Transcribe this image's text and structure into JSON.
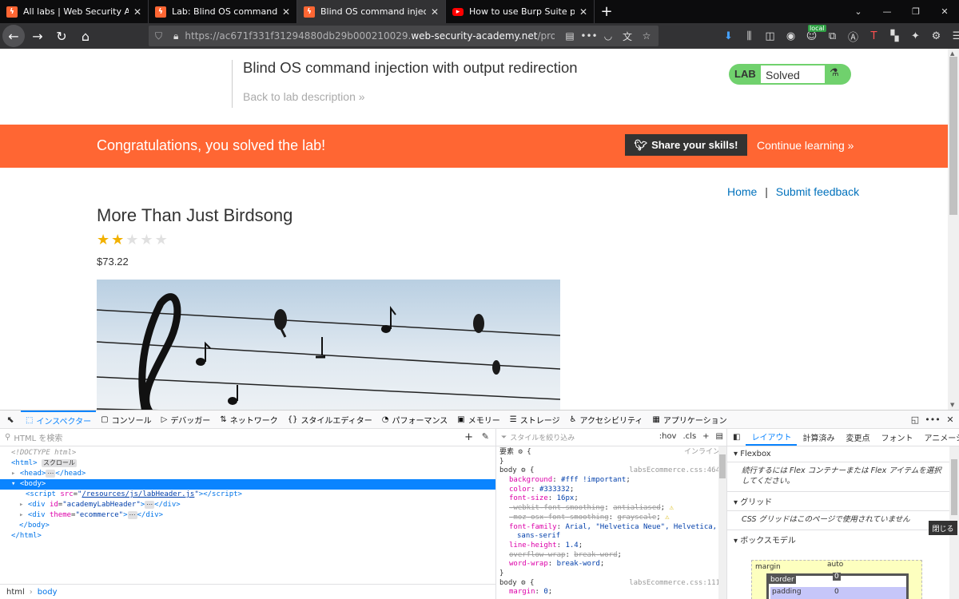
{
  "browser": {
    "tabs": [
      {
        "title": "All labs | Web Security Academy",
        "icon": "portswigger-icon"
      },
      {
        "title": "Lab: Blind OS command injection",
        "icon": "portswigger-icon"
      },
      {
        "title": "Blind OS command injection w",
        "icon": "portswigger-icon"
      },
      {
        "title": "How to use Burp Suite projects",
        "icon": "youtube-icon"
      }
    ],
    "url_prefix": "https://ac671f331f31294880db29b000210029.",
    "url_host": "web-security-academy.net",
    "url_path": "/product?productId",
    "local_badge": "local"
  },
  "page": {
    "lab_title": "Blind OS command injection with output redirection",
    "back_link": "Back to lab description »",
    "lab_label": "LAB",
    "lab_status": "Solved",
    "banner_text": "Congratulations, you solved the lab!",
    "share_button": "Share your skills!",
    "continue_link": "Continue learning »",
    "home_link": "Home",
    "separator": "|",
    "feedback_link": "Submit feedback",
    "product_title": "More Than Just Birdsong",
    "rating": 2,
    "rating_max": 5,
    "price": "$73.22"
  },
  "devtools": {
    "tabs": [
      {
        "label": "インスペクター",
        "icon": "⬚"
      },
      {
        "label": "コンソール",
        "icon": "▢"
      },
      {
        "label": "デバッガー",
        "icon": "▷"
      },
      {
        "label": "ネットワーク",
        "icon": "⇅"
      },
      {
        "label": "スタイルエディター",
        "icon": "{}"
      },
      {
        "label": "パフォーマンス",
        "icon": "◔"
      },
      {
        "label": "メモリー",
        "icon": "▣"
      },
      {
        "label": "ストレージ",
        "icon": "☰"
      },
      {
        "label": "アクセシビリティ",
        "icon": "♿"
      },
      {
        "label": "アプリケーション",
        "icon": "▦"
      }
    ],
    "html_search_placeholder": "HTML を検索",
    "tree": {
      "doctype": "<!DOCTYPE html>",
      "html_open": "<html>",
      "scroll_badge": "スクロール",
      "head": "<head>",
      "head_close": "</head>",
      "body_open": "<body>",
      "script_src": "/resources/js/labHeader.js",
      "div1_id": "academyLabHeader",
      "div2_theme": "ecommerce",
      "body_close": "</body>",
      "html_close": "</html>"
    },
    "breadcrumb": [
      "html",
      "body"
    ],
    "rules": {
      "filter_placeholder": "スタイルを絞り込み",
      "hov": ":hov",
      "cls": ".cls",
      "element_label": "要素",
      "inline_label": "インライン",
      "selector": "body",
      "source1": "labsEcommerce.css:464",
      "source2": "labsEcommerce.css:111",
      "props": [
        {
          "name": "background",
          "value": "#fff !important",
          "struck": false,
          "warn": false
        },
        {
          "name": "color",
          "value": "#333332",
          "struck": false,
          "warn": false
        },
        {
          "name": "font-size",
          "value": "16px",
          "struck": false,
          "warn": false
        },
        {
          "name": "-webkit-font-smoothing",
          "value": "antialiased",
          "struck": true,
          "warn": true
        },
        {
          "name": "-moz-osx-font-smoothing",
          "value": "grayscale",
          "struck": true,
          "warn": true
        },
        {
          "name": "font-family",
          "value": "Arial, \"Helvetica Neue\", Helvetica,",
          "struck": false,
          "warn": false
        },
        {
          "name": "",
          "value": "sans-serif",
          "struck": false,
          "warn": false
        },
        {
          "name": "line-height",
          "value": "1.4",
          "struck": false,
          "warn": false
        },
        {
          "name": "overflow-wrap",
          "value": "break-word",
          "struck": true,
          "warn": false
        },
        {
          "name": "word-wrap",
          "value": "break-word",
          "struck": false,
          "warn": false
        }
      ],
      "next_prop": "margin",
      "next_value": "0"
    },
    "layout": {
      "tabs": [
        "レイアウト",
        "計算済み",
        "変更点",
        "フォント",
        "アニメーション"
      ],
      "flexbox_title": "Flexbox",
      "flexbox_text": "続行するには Flex コンテナーまたは Flex アイテムを選択してください。",
      "grid_title": "グリッド",
      "grid_text": "CSS グリッドはこのページで使用されていません",
      "boxmodel_title": "ボックスモデル",
      "margin_label": "margin",
      "margin_value": "auto",
      "border_label": "border",
      "border_value": "0",
      "padding_label": "padding",
      "padding_value": "0",
      "close_label": "閉じる"
    }
  }
}
